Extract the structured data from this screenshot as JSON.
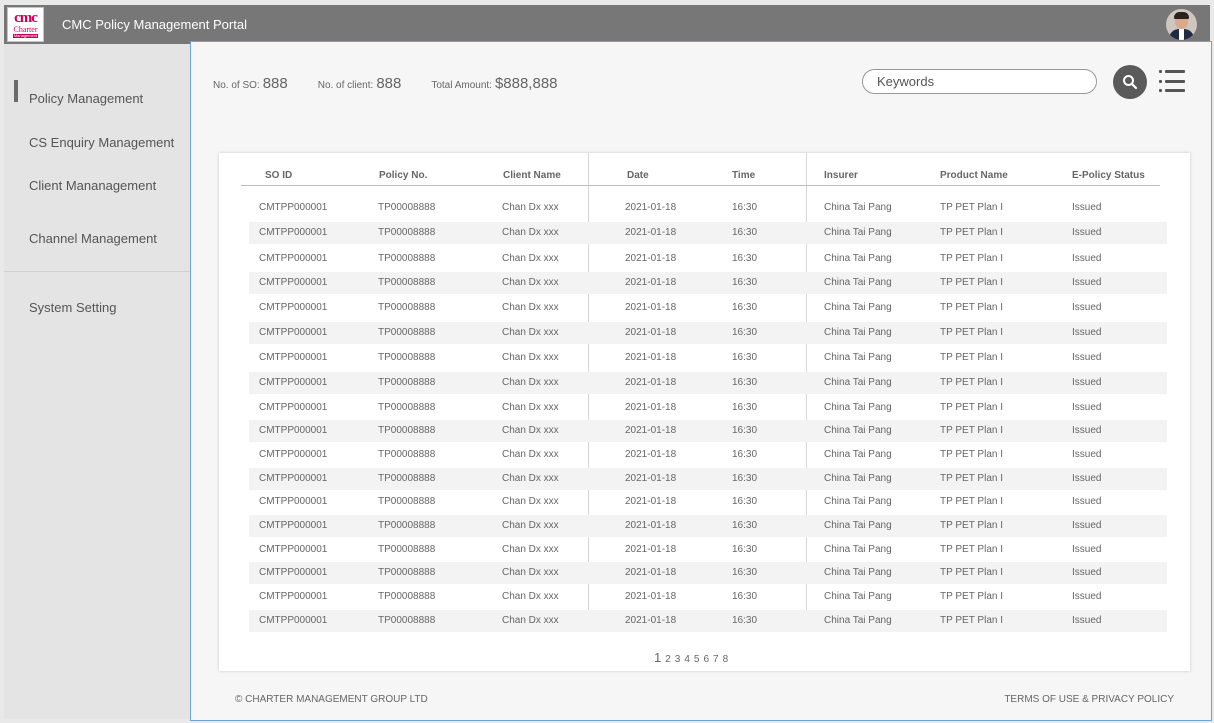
{
  "header": {
    "logo": {
      "line1": "cmc",
      "line2": "Charter",
      "line3": "Management"
    },
    "title": "CMC Policy Management Portal"
  },
  "sidebar": {
    "items": [
      {
        "label": "Policy  Management",
        "active": true
      },
      {
        "label": "CS Enquiry Management"
      },
      {
        "label": "Client Mananagement"
      },
      {
        "label": "Channel Management"
      },
      {
        "label": "System Setting"
      }
    ]
  },
  "stats": [
    {
      "label": "No. of SO:",
      "value": "888"
    },
    {
      "label": "No. of client:",
      "value": "888"
    },
    {
      "label": "Total Amount:",
      "value": "$888,888"
    }
  ],
  "search": {
    "placeholder": "Keywords",
    "icon": "search-icon"
  },
  "menu": {
    "icon": "list-menu-icon"
  },
  "table": {
    "columns": [
      "SO ID",
      "Policy No.",
      "Client Name",
      "Date",
      "Time",
      "Insurer",
      "Product Name",
      "E-Policy Status"
    ],
    "rows": [
      [
        "CMTPP000001",
        "TP00008888",
        "Chan Dx xxx",
        "2021-01-18",
        "16:30",
        "China Tai Pang",
        "TP PET Plan I",
        "Issued"
      ],
      [
        "CMTPP000001",
        "TP00008888",
        "Chan Dx xxx",
        "2021-01-18",
        "16:30",
        "China Tai Pang",
        "TP PET Plan I",
        "Issued"
      ],
      [
        "CMTPP000001",
        "TP00008888",
        "Chan Dx xxx",
        "2021-01-18",
        "16:30",
        "China Tai Pang",
        "TP PET Plan I",
        "Issued"
      ],
      [
        "CMTPP000001",
        "TP00008888",
        "Chan Dx xxx",
        "2021-01-18",
        "16:30",
        "China Tai Pang",
        "TP PET Plan I",
        "Issued"
      ],
      [
        "CMTPP000001",
        "TP00008888",
        "Chan Dx xxx",
        "2021-01-18",
        "16:30",
        "China Tai Pang",
        "TP PET Plan I",
        "Issued"
      ],
      [
        "CMTPP000001",
        "TP00008888",
        "Chan Dx xxx",
        "2021-01-18",
        "16:30",
        "China Tai Pang",
        "TP PET Plan I",
        "Issued"
      ],
      [
        "CMTPP000001",
        "TP00008888",
        "Chan Dx xxx",
        "2021-01-18",
        "16:30",
        "China Tai Pang",
        "TP PET Plan I",
        "Issued"
      ],
      [
        "CMTPP000001",
        "TP00008888",
        "Chan Dx xxx",
        "2021-01-18",
        "16:30",
        "China Tai Pang",
        "TP PET Plan I",
        "Issued"
      ],
      [
        "CMTPP000001",
        "TP00008888",
        "Chan Dx xxx",
        "2021-01-18",
        "16:30",
        "China Tai Pang",
        "TP PET Plan I",
        "Issued"
      ],
      [
        "CMTPP000001",
        "TP00008888",
        "Chan Dx xxx",
        "2021-01-18",
        "16:30",
        "China Tai Pang",
        "TP PET Plan I",
        "Issued"
      ],
      [
        "CMTPP000001",
        "TP00008888",
        "Chan Dx xxx",
        "2021-01-18",
        "16:30",
        "China Tai Pang",
        "TP PET Plan I",
        "Issued"
      ],
      [
        "CMTPP000001",
        "TP00008888",
        "Chan Dx xxx",
        "2021-01-18",
        "16:30",
        "China Tai Pang",
        "TP PET Plan I",
        "Issued"
      ],
      [
        "CMTPP000001",
        "TP00008888",
        "Chan Dx xxx",
        "2021-01-18",
        "16:30",
        "China Tai Pang",
        "TP PET Plan I",
        "Issued"
      ],
      [
        "CMTPP000001",
        "TP00008888",
        "Chan Dx xxx",
        "2021-01-18",
        "16:30",
        "China Tai Pang",
        "TP PET Plan I",
        "Issued"
      ],
      [
        "CMTPP000001",
        "TP00008888",
        "Chan Dx xxx",
        "2021-01-18",
        "16:30",
        "China Tai Pang",
        "TP PET Plan I",
        "Issued"
      ],
      [
        "CMTPP000001",
        "TP00008888",
        "Chan Dx xxx",
        "2021-01-18",
        "16:30",
        "China Tai Pang",
        "TP PET Plan I",
        "Issued"
      ],
      [
        "CMTPP000001",
        "TP00008888",
        "Chan Dx xxx",
        "2021-01-18",
        "16:30",
        "China Tai Pang",
        "TP PET Plan I",
        "Issued"
      ],
      [
        "CMTPP000001",
        "TP00008888",
        "Chan Dx xxx",
        "2021-01-18",
        "16:30",
        "China Tai Pang",
        "TP PET Plan I",
        "Issued"
      ]
    ]
  },
  "pagination": {
    "pages": [
      "1",
      "2",
      "3",
      "4",
      "5",
      "6",
      "7",
      "8"
    ],
    "current": "1"
  },
  "footer": {
    "copyright": "© CHARTER MANAGEMENT GROUP LTD",
    "links": "TERMS OF USE & PRIVACY POLICY"
  }
}
